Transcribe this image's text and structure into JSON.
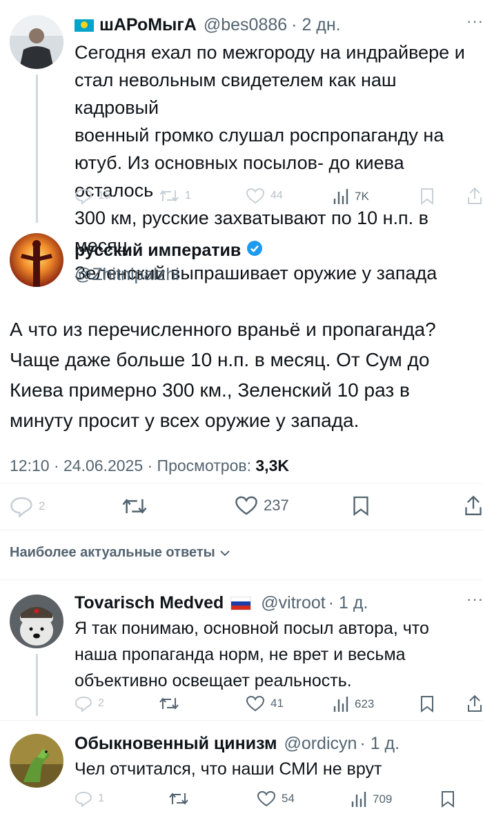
{
  "tweet1": {
    "name": "шАРоМыгА",
    "handle": "@bes0886",
    "time": "· 2 дн.",
    "lines": [
      "Сегодня ехал по межгороду на индрайвере и",
      "стал невольным свидетелем как наш кадровый",
      "военный громко слушал роспропаганду на",
      "ютуб. Из основных посылов- до киева осталось",
      "300 км, русские захватывают по 10 н.п. в месяц,",
      "Зеленский выпрашивает оружие у запада"
    ],
    "replies": "15",
    "retweets": "1",
    "likes": "44",
    "views": "7K"
  },
  "main": {
    "name": "русский императив",
    "handle": "@Zhitnipalzhi",
    "lines": [
      "А что из перечисленного враньё и пропаганда?",
      "Чаще даже больше 10 н.п. в месяц. От Сум до",
      "Киева примерно 300 км., Зеленский 10 раз в",
      "минуту просит у всех оружие у запада."
    ],
    "meta": "12:10 · 24.06.2025 · Просмотров: ",
    "views": "3,3K",
    "replies": "2",
    "likes": "237"
  },
  "sort_label": "Наиболее актуальные ответы",
  "reply1": {
    "name": "Tovarisch Medved",
    "handle": "@vitroot",
    "time": "· 1 д.",
    "lines": [
      "Я так понимаю, основной посыл автора, что",
      "наша пропаганда норм, не врет и весьма",
      "объективно освещает реальность."
    ],
    "replies": "2",
    "likes": "41",
    "views": "623"
  },
  "reply2": {
    "name": "Обыкновенный цинизм",
    "handle": "@ordicyn",
    "time": "· 1 д.",
    "lines": [
      "Чел отчитался, что наши СМИ не врут"
    ],
    "replies": "1",
    "likes": "54",
    "views": "709"
  },
  "colors": {
    "accent": "#1d9bf0",
    "muted": "#536471",
    "divider": "#eff3f4"
  }
}
